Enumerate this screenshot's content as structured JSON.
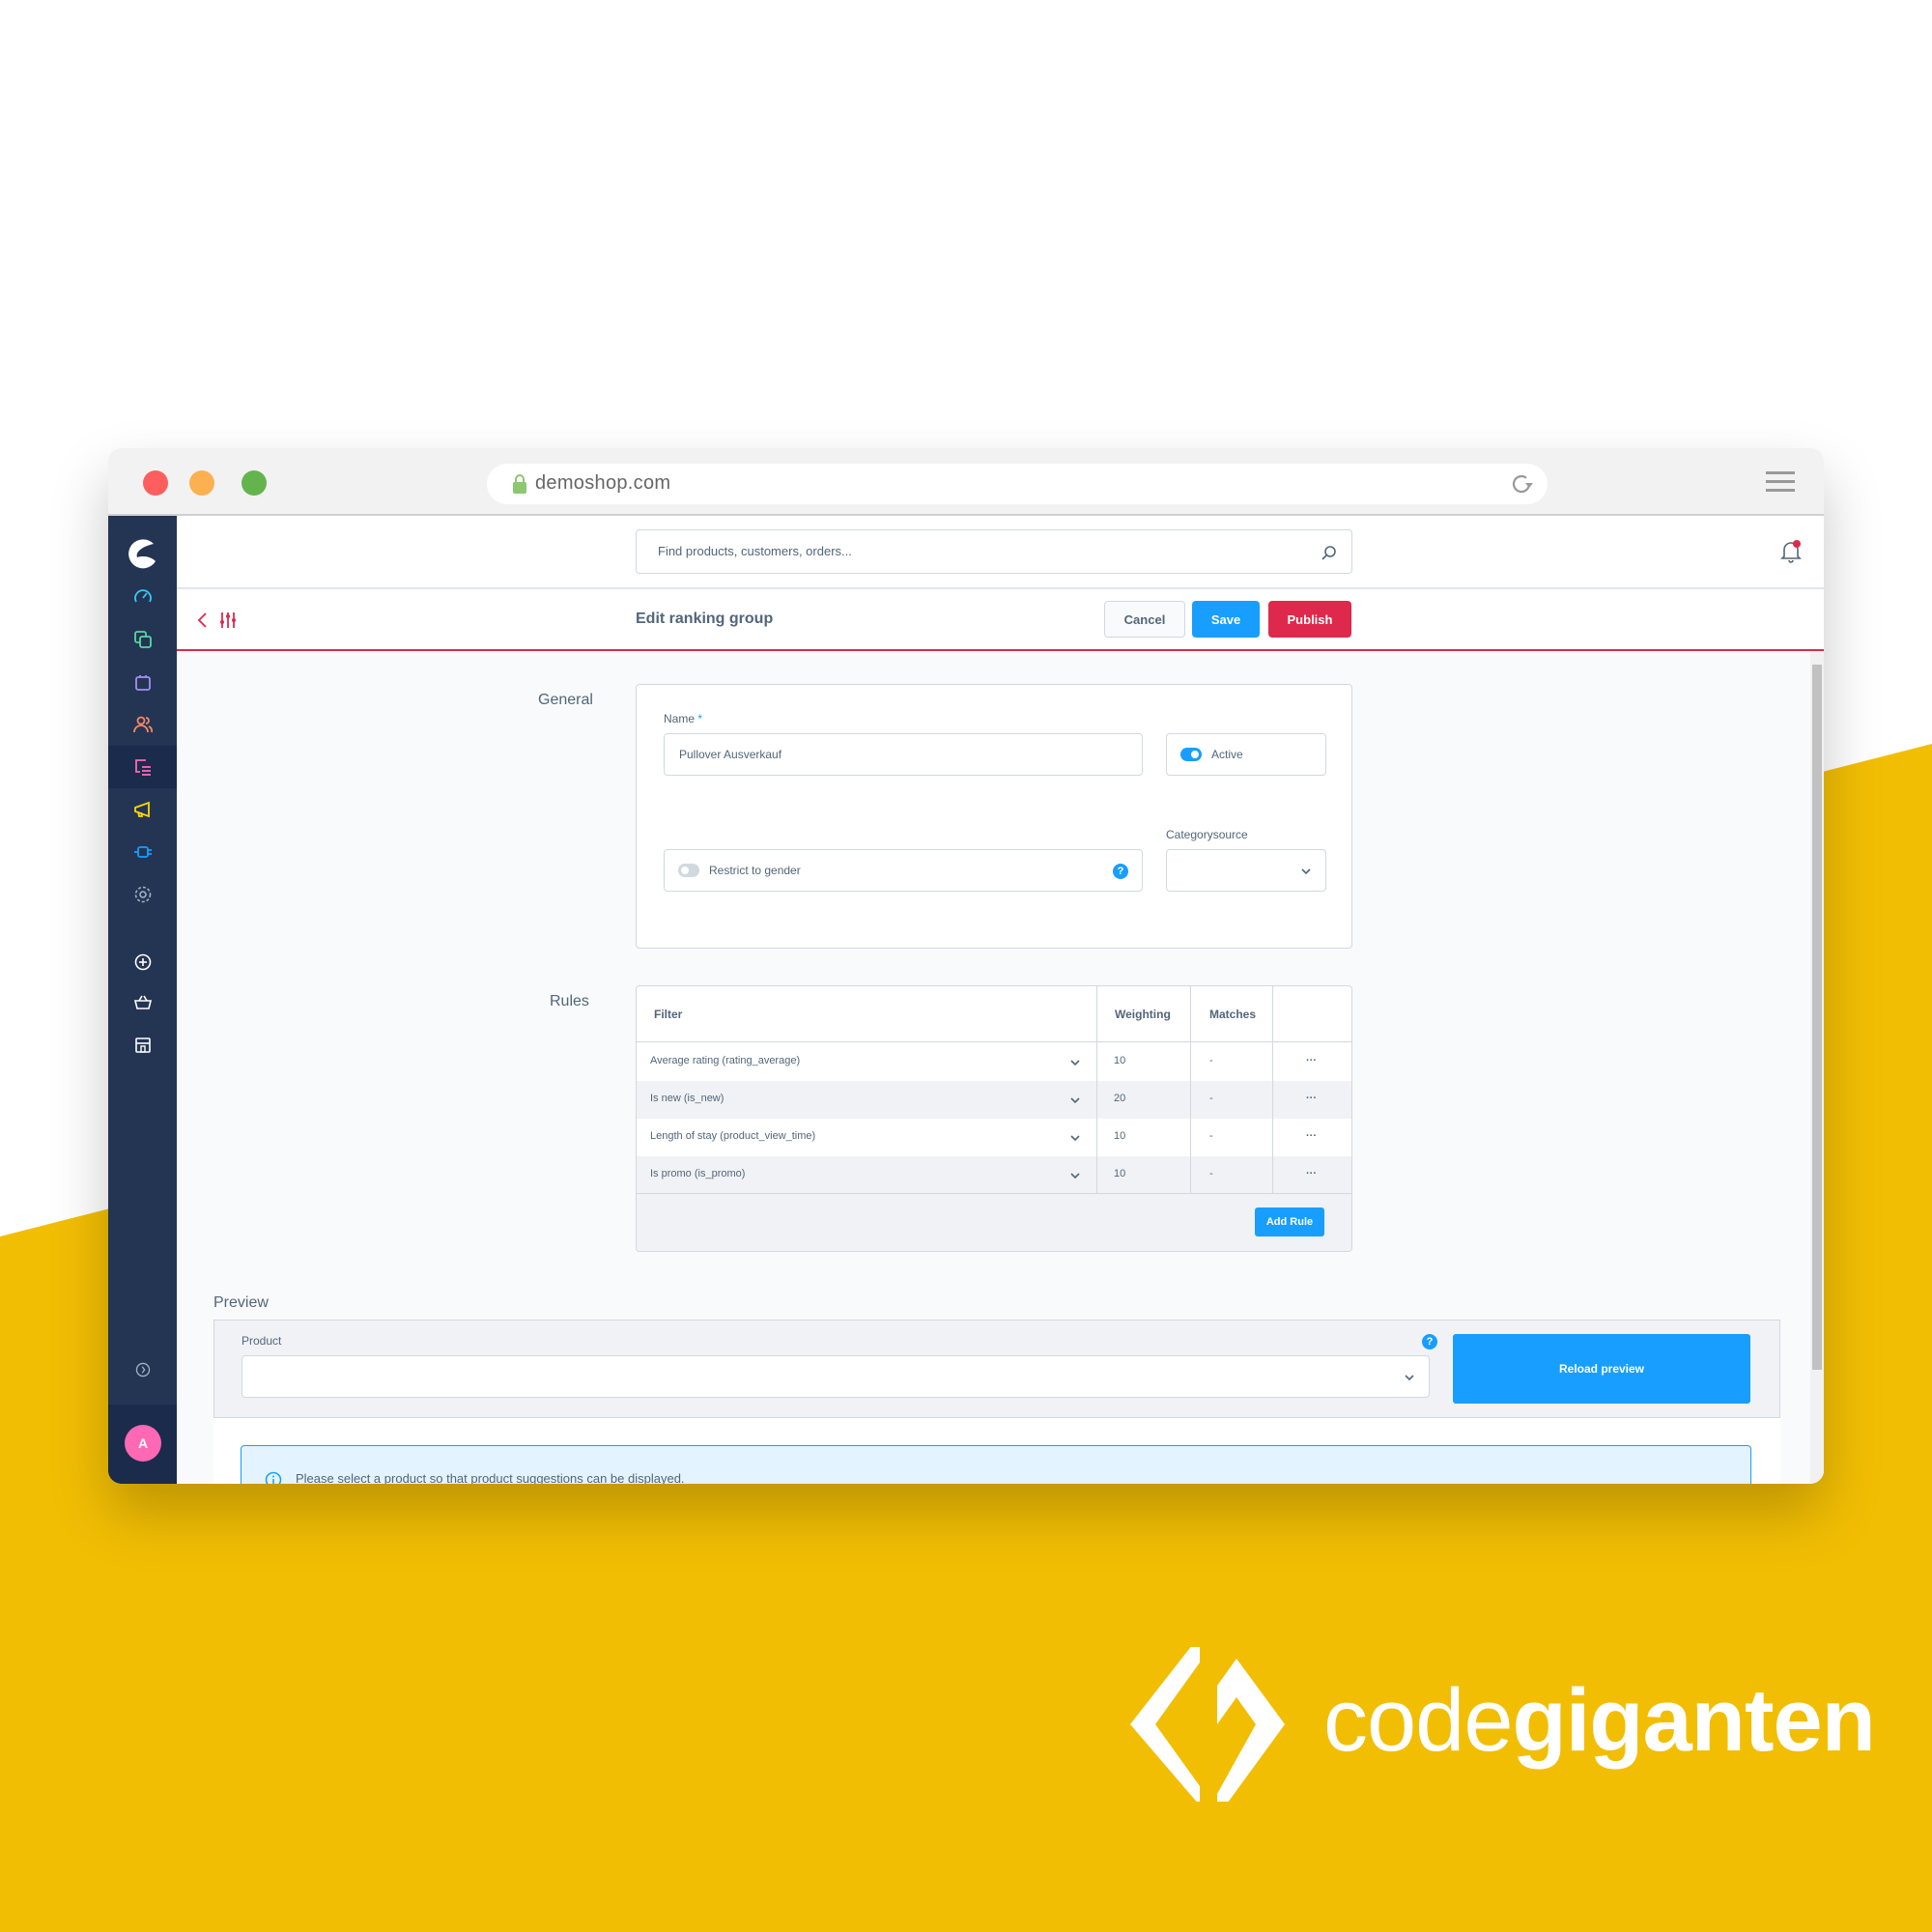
{
  "browser": {
    "url": "demoshop.com",
    "traffic_lights": [
      "close",
      "minimize",
      "maximize"
    ]
  },
  "sidebar": {
    "items": [
      {
        "name": "dashboard",
        "icon": "gauge-icon",
        "color": "#3ac9f5"
      },
      {
        "name": "catalogues",
        "icon": "copy-icon",
        "color": "#57d9a3"
      },
      {
        "name": "orders",
        "icon": "shopping-bag-icon",
        "color": "#a092f0"
      },
      {
        "name": "customers",
        "icon": "users-icon",
        "color": "#f88962"
      },
      {
        "name": "content",
        "icon": "content-list-icon",
        "color": "#ff68b4",
        "active": true
      },
      {
        "name": "marketing",
        "icon": "megaphone-icon",
        "color": "#ffd700"
      },
      {
        "name": "extensions",
        "icon": "plug-icon",
        "color": "#189eff"
      },
      {
        "name": "settings",
        "icon": "gear-icon",
        "color": "#a2b1c4"
      },
      {
        "name": "add",
        "icon": "plus-circle-icon",
        "color": "#ffffff"
      },
      {
        "name": "sales-channel-basket",
        "icon": "basket-icon",
        "color": "#ffffff"
      },
      {
        "name": "sales-channel-store",
        "icon": "store-icon",
        "color": "#ffffff"
      }
    ],
    "collapse_icon": "chevron-right-circle-icon",
    "avatar_initial": "A"
  },
  "topbar": {
    "search_placeholder": "Find products, customers, orders..."
  },
  "smartbar": {
    "title": "Edit ranking group",
    "cancel_label": "Cancel",
    "save_label": "Save",
    "publish_label": "Publish"
  },
  "general": {
    "section_label": "General",
    "name_label": "Name",
    "name_required_mark": "*",
    "name_value": "Pullover Ausverkauf",
    "active_label": "Active",
    "active_on": true,
    "restrict_gender_label": "Restrict to gender",
    "restrict_gender_on": false,
    "help_mark": "?",
    "categorysource_label": "Categorysource",
    "categorysource_value": ""
  },
  "rules": {
    "section_label": "Rules",
    "headers": {
      "filter": "Filter",
      "weighting": "Weighting",
      "matches": "Matches"
    },
    "rows": [
      {
        "filter": "Average rating (rating_average)",
        "weighting": "10",
        "matches": "-",
        "actions": "···"
      },
      {
        "filter": "Is new (is_new)",
        "weighting": "20",
        "matches": "-",
        "actions": "···"
      },
      {
        "filter": "Length of stay (product_view_time)",
        "weighting": "10",
        "matches": "-",
        "actions": "···"
      },
      {
        "filter": "Is promo (is_promo)",
        "weighting": "10",
        "matches": "-",
        "actions": "···"
      }
    ],
    "add_rule_label": "Add Rule"
  },
  "preview": {
    "section_label": "Preview",
    "product_label": "Product",
    "product_value": "",
    "help_mark": "?",
    "reload_label": "Reload preview",
    "info_text": "Please select a product so that product suggestions can be displayed."
  },
  "brand": {
    "light": "code",
    "bold": "giganten"
  },
  "colors": {
    "primary": "#189eff",
    "danger": "#de294c",
    "sidebar": "#243554",
    "brand_yellow": "#f2be04",
    "avatar": "#ff68b4"
  }
}
